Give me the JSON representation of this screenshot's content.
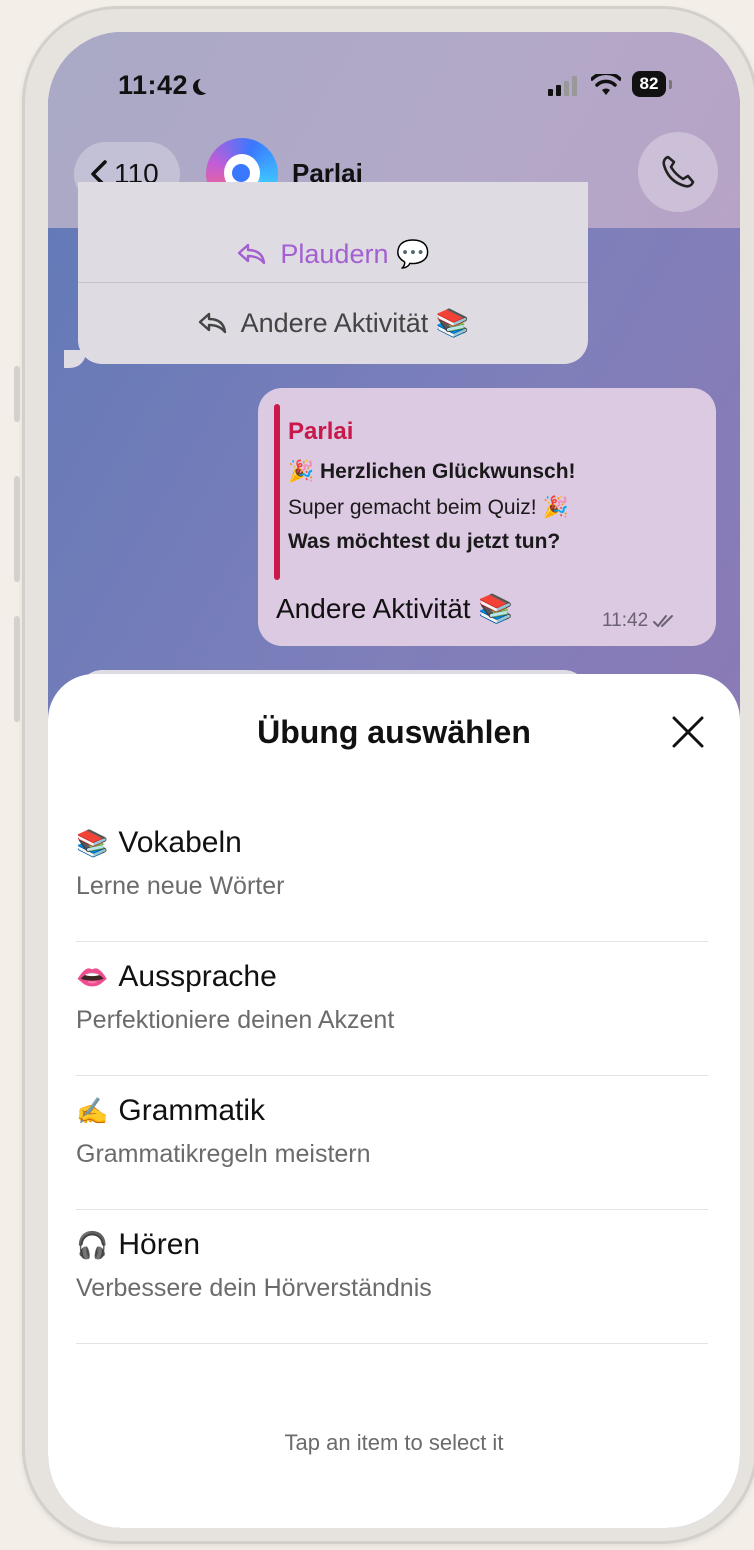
{
  "status_bar": {
    "time": "11:42",
    "battery": "82"
  },
  "header": {
    "back_count": "110",
    "chat_name": "Parlai"
  },
  "incoming_message": {
    "buttons": [
      {
        "label": "Plaudern 💬"
      },
      {
        "label": "Andere Aktivität 📚"
      }
    ]
  },
  "outgoing_message": {
    "quote": {
      "sender": "Parlai",
      "lines": [
        "🎉 Herzlichen Glückwunsch!",
        "Super gemacht beim Quiz! 🎉",
        "Was möchtest du jetzt tun?"
      ]
    },
    "text": "Andere Aktivität 📚",
    "time": "11:42"
  },
  "sheet": {
    "title": "Übung auswählen",
    "options": [
      {
        "emoji": "📚",
        "title": "Vokabeln",
        "subtitle": "Lerne neue Wörter"
      },
      {
        "emoji": "👄",
        "title": "Aussprache",
        "subtitle": "Perfektioniere deinen Akzent"
      },
      {
        "emoji": "✍️",
        "title": "Grammatik",
        "subtitle": "Grammatikregeln meistern"
      },
      {
        "emoji": "🎧",
        "title": "Hören",
        "subtitle": "Verbessere dein Hörverständnis"
      }
    ],
    "hint": "Tap an item to select it"
  },
  "colors": {
    "accent_purple": "#a460d0",
    "quote_red": "#c9184a",
    "outgoing_bubble": "#dcc9e2",
    "incoming_bubble": "#dedbe3"
  }
}
